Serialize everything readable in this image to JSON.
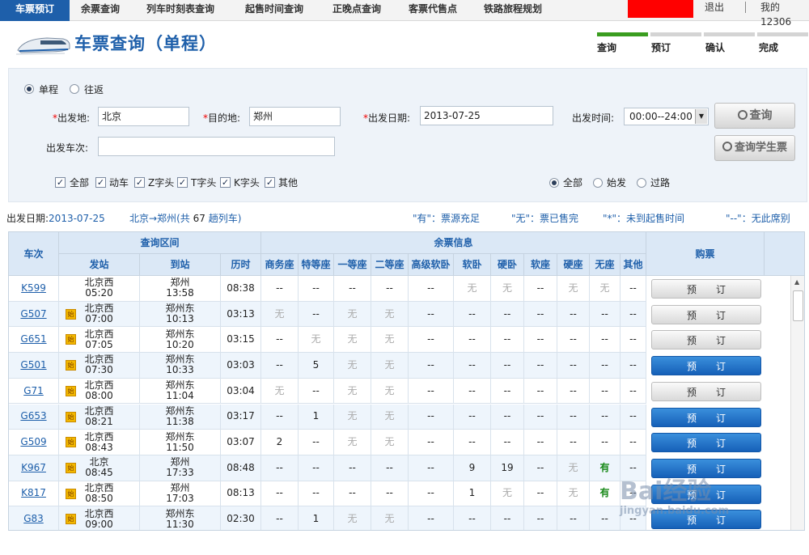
{
  "nav": {
    "tabs": [
      "车票预订",
      "余票查询",
      "列车时刻表查询",
      "起售时间查询",
      "正晚点查询",
      "客票代售点",
      "铁路旅程规划"
    ],
    "logout": "退出",
    "my12306": "我的12306"
  },
  "page": {
    "title": "车票查询（单程）"
  },
  "steps": [
    "查询",
    "预订",
    "确认",
    "完成"
  ],
  "colors": {
    "primary": "#1e5faa",
    "step_active": "#3a9d1f",
    "book_blue": "#1660b8"
  },
  "form": {
    "trip_types": [
      "单程",
      "往返"
    ],
    "trip_selected": "单程",
    "from_label": "出发地:",
    "from_value": "北京",
    "to_label": "目的地:",
    "to_value": "郑州",
    "date_label": "出发日期:",
    "date_value": "2013-07-25",
    "time_label": "出发时间:",
    "time_value": "00:00--24:00",
    "query_button": "查询",
    "student_button": "查询学生票",
    "train_no_label": "出发车次:",
    "train_no_value": "",
    "train_types": [
      "全部",
      "动车",
      "Z字头",
      "T字头",
      "K字头",
      "其他"
    ],
    "station_filters": [
      "全部",
      "始发",
      "过路"
    ],
    "station_selected": "全部"
  },
  "summary": {
    "date_label": "出发日期:",
    "date": "2013-07-25",
    "route": "北京→郑州",
    "count_prefix": "(共",
    "count": "67",
    "count_suffix": "趟列车)",
    "legend": [
      "\"有\"：票源充足",
      "\"无\"：票已售完",
      "\"*\"：未到起售时间",
      "\"--\"：无此席别"
    ]
  },
  "table": {
    "header": {
      "train": "车次",
      "interval": "查询区间",
      "depart": "发站",
      "arrive": "到站",
      "duration": "历时",
      "seats_group": "余票信息",
      "buy": "购票",
      "seats": [
        "商务座",
        "特等座",
        "一等座",
        "二等座",
        "高级软卧",
        "软卧",
        "硬卧",
        "软座",
        "硬座",
        "无座",
        "其他"
      ]
    },
    "book_label": "预订",
    "start_badge": "始",
    "rows": [
      {
        "train": "K599",
        "start": false,
        "from": "北京西",
        "dep": "05:20",
        "to": "郑州",
        "arr": "13:58",
        "dur": "08:38",
        "seats": [
          "--",
          "--",
          "--",
          "--",
          "--",
          "无",
          "无",
          "--",
          "无",
          "无",
          "--"
        ],
        "book": "gray"
      },
      {
        "train": "G507",
        "start": true,
        "from": "北京西",
        "dep": "07:00",
        "to": "郑州东",
        "arr": "10:13",
        "dur": "03:13",
        "seats": [
          "无",
          "--",
          "无",
          "无",
          "--",
          "--",
          "--",
          "--",
          "--",
          "--",
          "--"
        ],
        "book": "gray"
      },
      {
        "train": "G651",
        "start": true,
        "from": "北京西",
        "dep": "07:05",
        "to": "郑州东",
        "arr": "10:20",
        "dur": "03:15",
        "seats": [
          "--",
          "无",
          "无",
          "无",
          "--",
          "--",
          "--",
          "--",
          "--",
          "--",
          "--"
        ],
        "book": "gray"
      },
      {
        "train": "G501",
        "start": true,
        "from": "北京西",
        "dep": "07:30",
        "to": "郑州东",
        "arr": "10:33",
        "dur": "03:03",
        "seats": [
          "--",
          "5",
          "无",
          "无",
          "--",
          "--",
          "--",
          "--",
          "--",
          "--",
          "--"
        ],
        "book": "blue"
      },
      {
        "train": "G71",
        "start": true,
        "from": "北京西",
        "dep": "08:00",
        "to": "郑州东",
        "arr": "11:04",
        "dur": "03:04",
        "seats": [
          "无",
          "--",
          "无",
          "无",
          "--",
          "--",
          "--",
          "--",
          "--",
          "--",
          "--"
        ],
        "book": "gray"
      },
      {
        "train": "G653",
        "start": true,
        "from": "北京西",
        "dep": "08:21",
        "to": "郑州东",
        "arr": "11:38",
        "dur": "03:17",
        "seats": [
          "--",
          "1",
          "无",
          "无",
          "--",
          "--",
          "--",
          "--",
          "--",
          "--",
          "--"
        ],
        "book": "blue"
      },
      {
        "train": "G509",
        "start": true,
        "from": "北京西",
        "dep": "08:43",
        "to": "郑州东",
        "arr": "11:50",
        "dur": "03:07",
        "seats": [
          "2",
          "--",
          "无",
          "无",
          "--",
          "--",
          "--",
          "--",
          "--",
          "--",
          "--"
        ],
        "book": "blue"
      },
      {
        "train": "K967",
        "start": true,
        "from": "北京",
        "dep": "08:45",
        "to": "郑州",
        "arr": "17:33",
        "dur": "08:48",
        "seats": [
          "--",
          "--",
          "--",
          "--",
          "--",
          "9",
          "19",
          "--",
          "无",
          "有",
          "--"
        ],
        "book": "blue"
      },
      {
        "train": "K817",
        "start": true,
        "from": "北京西",
        "dep": "08:50",
        "to": "郑州",
        "arr": "17:03",
        "dur": "08:13",
        "seats": [
          "--",
          "--",
          "--",
          "--",
          "--",
          "1",
          "无",
          "--",
          "无",
          "有",
          "--"
        ],
        "book": "blue"
      },
      {
        "train": "G83",
        "start": true,
        "from": "北京西",
        "dep": "09:00",
        "to": "郑州东",
        "arr": "11:30",
        "dur": "02:30",
        "seats": [
          "--",
          "1",
          "无",
          "无",
          "--",
          "--",
          "--",
          "--",
          "--",
          "--",
          "--"
        ],
        "book": "blue"
      }
    ]
  },
  "watermark": {
    "brand": "Bai经验",
    "url": "jingyan.baidu.com"
  }
}
